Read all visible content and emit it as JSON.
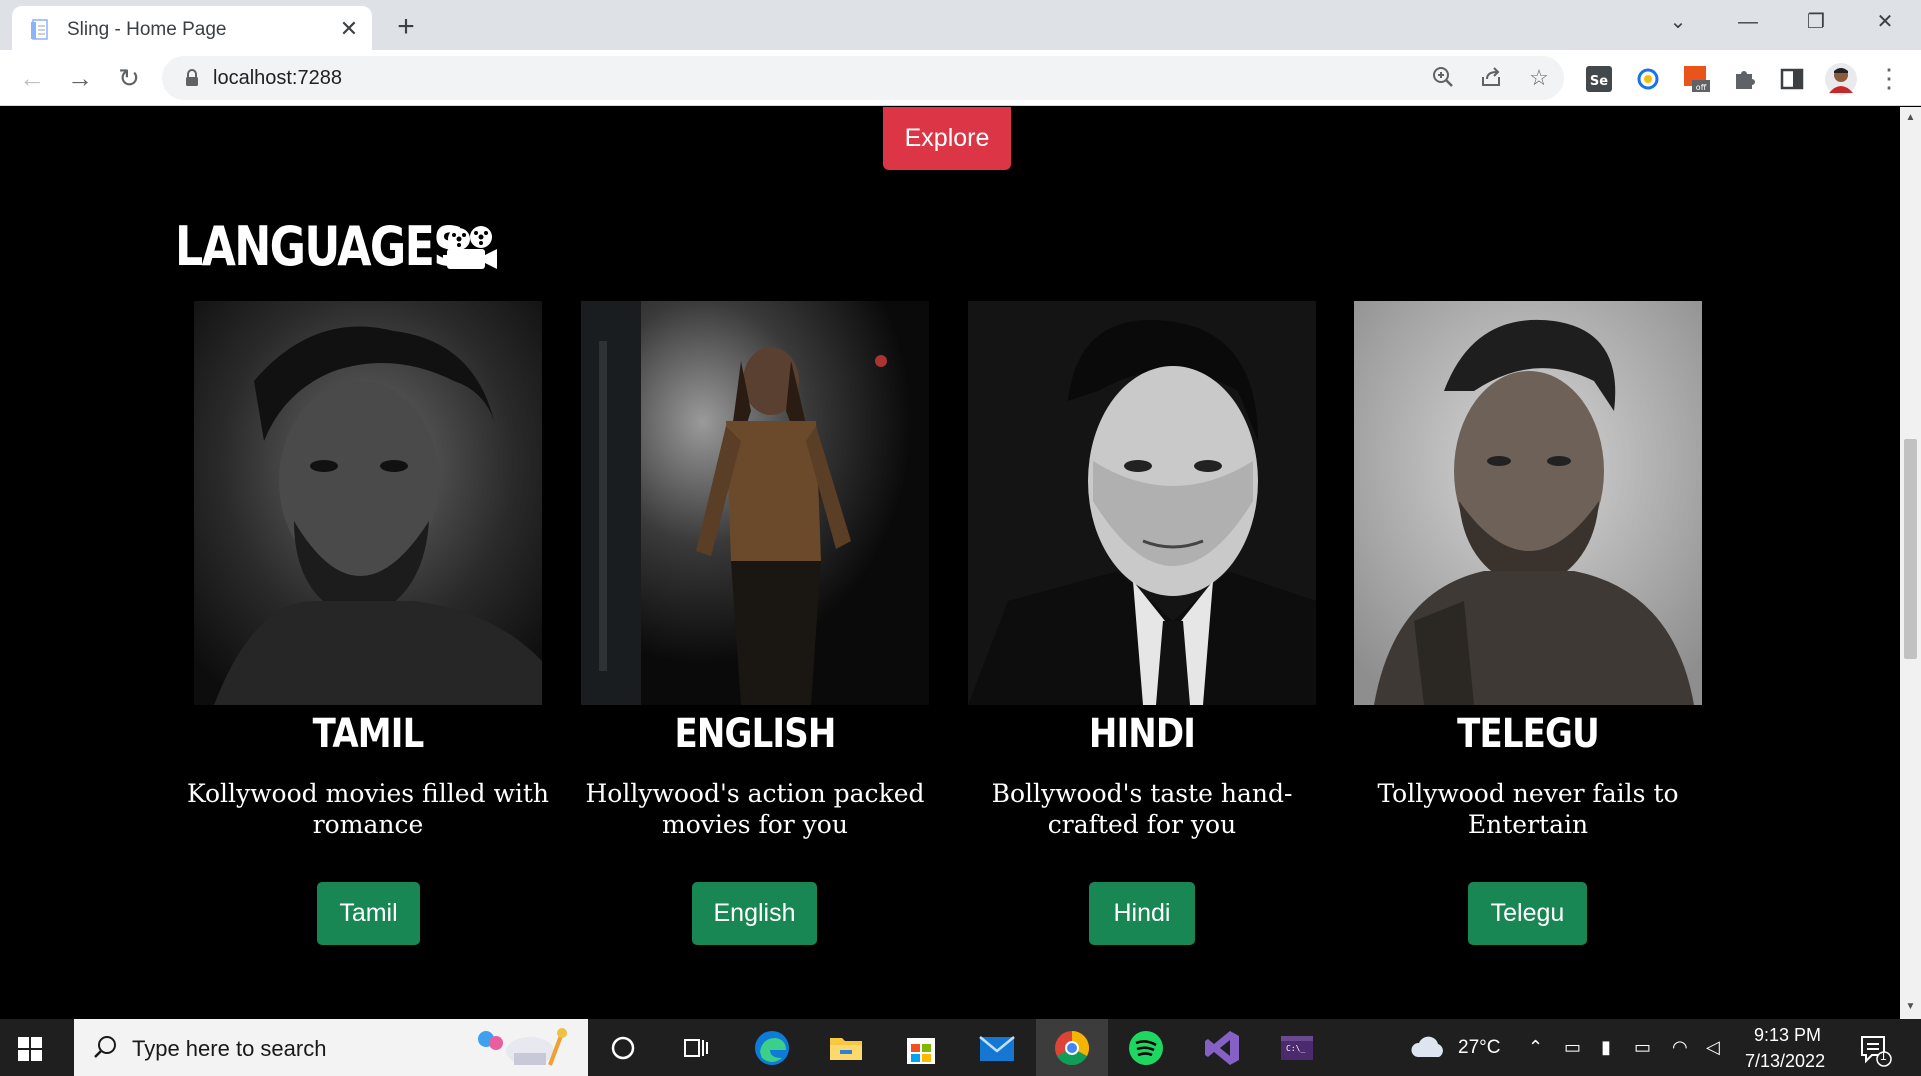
{
  "browser": {
    "tab_title": "Sling - Home Page",
    "url": "localhost:7288"
  },
  "page": {
    "explore_label": "Explore",
    "section_title": "LANGUAGES",
    "cards": [
      {
        "title": "TAMIL",
        "text": "Kollywood movies filled with romance",
        "button": "Tamil"
      },
      {
        "title": "ENGLISH",
        "text": "Hollywood's action packed movies for you",
        "button": "English"
      },
      {
        "title": "HINDI",
        "text": "Bollywood's taste hand-crafted for you",
        "button": "Hindi"
      },
      {
        "title": "TELEGU",
        "text": "Tollywood never fails to Entertain",
        "button": "Telegu"
      }
    ],
    "colors": {
      "explore": "#dc3545",
      "card_button": "#198754",
      "background": "#000000"
    }
  },
  "taskbar": {
    "search_placeholder": "Type here to search",
    "weather": "27°C",
    "time": "9:13 PM",
    "date": "7/13/2022",
    "notification_count": "1"
  }
}
